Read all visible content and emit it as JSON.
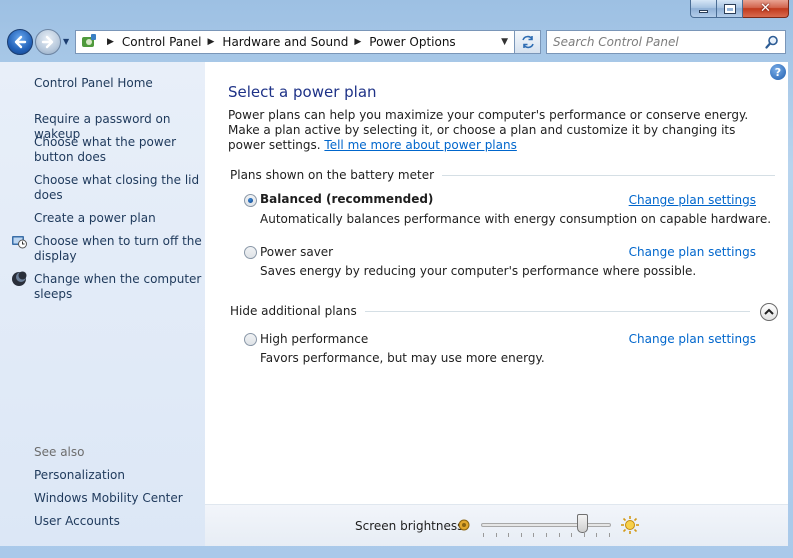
{
  "window": {
    "minimize_label": "",
    "maximize_label": "",
    "close_label": "✕"
  },
  "navbar": {
    "breadcrumbs": [
      "Control Panel",
      "Hardware and Sound",
      "Power Options"
    ],
    "search_placeholder": "Search Control Panel"
  },
  "sidebar": {
    "home": "Control Panel Home",
    "links": [
      "Require a password on wakeup",
      "Choose what the power button does",
      "Choose what closing the lid does",
      "Create a power plan",
      "Choose when to turn off the display",
      "Change when the computer sleeps"
    ],
    "see_also_heading": "See also",
    "see_also_links": [
      "Personalization",
      "Windows Mobility Center",
      "User Accounts"
    ]
  },
  "main": {
    "title": "Select a power plan",
    "intro_text": "Power plans can help you maximize your computer's performance or conserve energy. Make a plan active by selecting it, or choose a plan and customize it by changing its power settings.",
    "intro_link": "Tell me more about power plans",
    "battery_group_label": "Plans shown on the battery meter",
    "hidden_group_label": "Hide additional plans",
    "change_label": "Change plan settings",
    "plans": [
      {
        "name": "Balanced (recommended)",
        "desc": "Automatically balances performance with energy consumption on capable hardware.",
        "selected": true
      },
      {
        "name": "Power saver",
        "desc": "Saves energy by reducing your computer's performance where possible.",
        "selected": false
      },
      {
        "name": "High performance",
        "desc": "Favors performance, but may use more energy.",
        "selected": false
      }
    ]
  },
  "bottom": {
    "brightness_label": "Screen brightness:",
    "brightness_level": 0.78
  },
  "colors": {
    "link": "#0066cc",
    "title": "#1e3287",
    "sidebar_link": "#1e395b"
  }
}
